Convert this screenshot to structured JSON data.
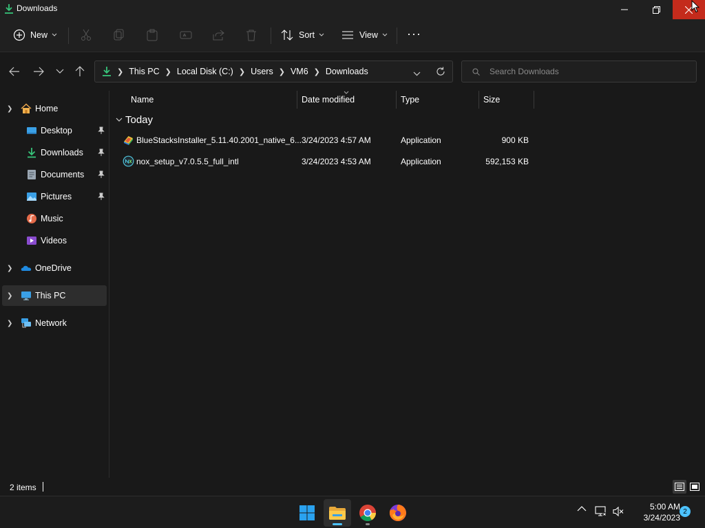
{
  "window": {
    "title": "Downloads"
  },
  "commandbar": {
    "new_label": "New",
    "sort_label": "Sort",
    "view_label": "View",
    "more_label": "···"
  },
  "address": {
    "crumbs": [
      "This PC",
      "Local Disk (C:)",
      "Users",
      "VM6",
      "Downloads"
    ]
  },
  "search": {
    "placeholder": "Search Downloads"
  },
  "sidebar": {
    "items": [
      {
        "label": "Home",
        "icon": "home-icon"
      },
      {
        "label": "Desktop",
        "icon": "desktop-icon",
        "pinned": true
      },
      {
        "label": "Downloads",
        "icon": "downloads-icon",
        "pinned": true
      },
      {
        "label": "Documents",
        "icon": "documents-icon",
        "pinned": true
      },
      {
        "label": "Pictures",
        "icon": "pictures-icon",
        "pinned": true
      },
      {
        "label": "Music",
        "icon": "music-icon"
      },
      {
        "label": "Videos",
        "icon": "videos-icon"
      },
      {
        "label": "OneDrive",
        "icon": "onedrive-icon"
      },
      {
        "label": "This PC",
        "icon": "this-pc-icon",
        "selected": true
      },
      {
        "label": "Network",
        "icon": "network-icon"
      }
    ]
  },
  "columns": {
    "name": "Name",
    "date": "Date modified",
    "type": "Type",
    "size": "Size"
  },
  "groups": {
    "today": "Today"
  },
  "files": [
    {
      "name": "BlueStacksInstaller_5.11.40.2001_native_6...",
      "date": "3/24/2023 4:57 AM",
      "type": "Application",
      "size": "900 KB",
      "icon": "bluestacks-icon"
    },
    {
      "name": "nox_setup_v7.0.5.5_full_intl",
      "date": "3/24/2023 4:53 AM",
      "type": "Application",
      "size": "592,153 KB",
      "icon": "nox-icon"
    }
  ],
  "status": {
    "item_count": "2 items"
  },
  "taskbar": {
    "time": "5:00 AM",
    "date": "3/24/2023",
    "notifications": "2"
  },
  "colors": {
    "accent": "#4cc2ff",
    "close_red": "#c42b1c",
    "background": "#191919",
    "chrome": "#202020"
  }
}
